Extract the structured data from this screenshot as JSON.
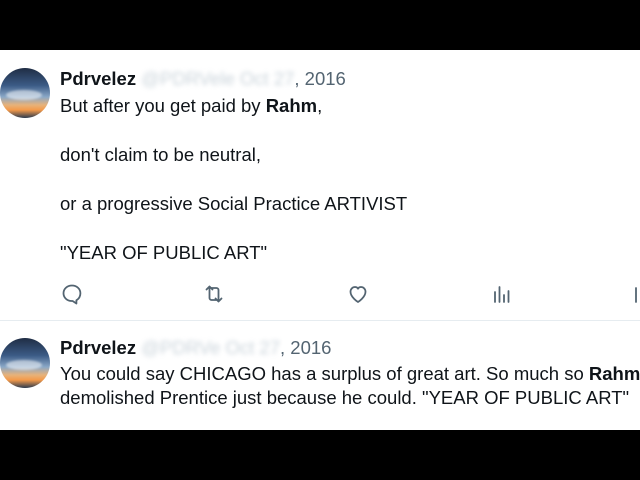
{
  "tweets": [
    {
      "name": "Pdrvelez",
      "handle": "@PDRVele",
      "date_blurred": "Oct 27",
      "date_visible": ", 2016",
      "lines": [
        {
          "pre": "But after you get paid by ",
          "bold": "Rahm",
          "post": ","
        },
        {
          "pre": "don't claim to be neutral,",
          "bold": "",
          "post": ""
        },
        {
          "pre": "or a progressive Social Practice ARTIVIST",
          "bold": "",
          "post": ""
        },
        {
          "pre": "\"YEAR OF PUBLIC ART\"",
          "bold": "",
          "post": ""
        }
      ],
      "actions": [
        "reply-icon",
        "retweet-icon",
        "like-icon",
        "views-icon",
        "share-icon"
      ]
    },
    {
      "name": "Pdrvelez",
      "handle": "@PDRVe",
      "date_blurred": "Oct 27",
      "date_visible": ", 2016",
      "lines": [
        {
          "pre": "You could say CHICAGO has a surplus of great art. So much so ",
          "bold": "Rahm",
          "post": ""
        },
        {
          "pre": "demolished Prentice just because he could. \"YEAR OF PUBLIC ART\"",
          "bold": "",
          "post": ""
        }
      ]
    }
  ],
  "colors": {
    "text": "#0f1419",
    "secondary": "#536471",
    "divider": "#e6ecf0"
  }
}
